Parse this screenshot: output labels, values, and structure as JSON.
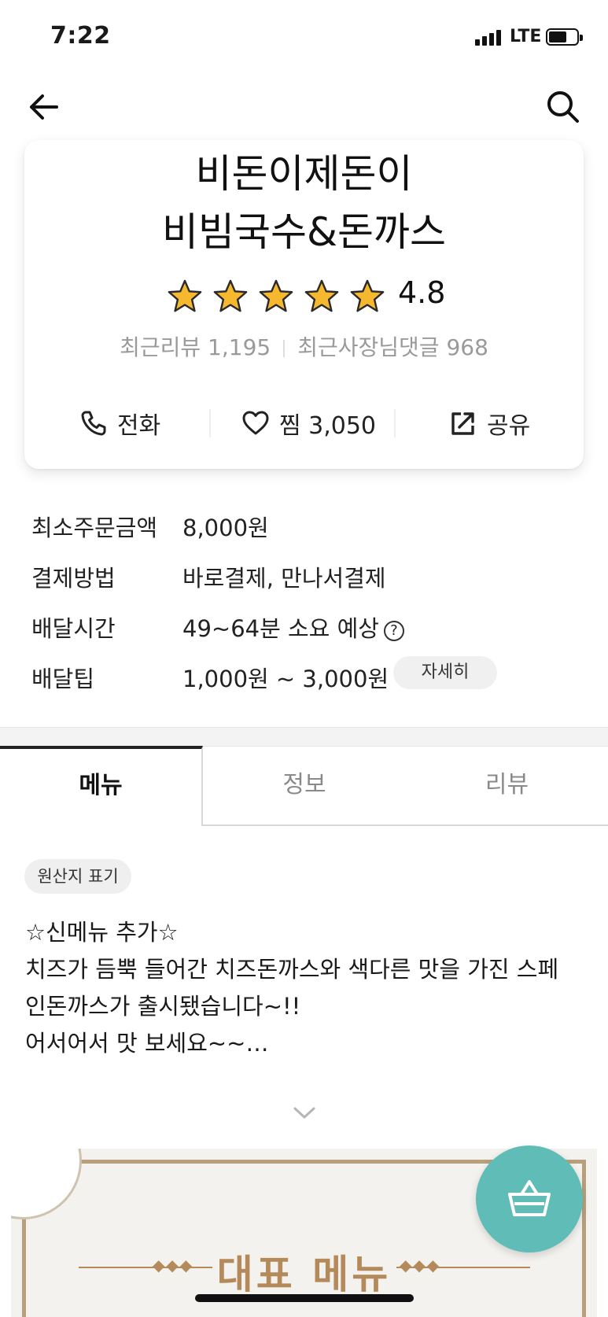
{
  "status_bar": {
    "time": "7:22",
    "network": "LTE"
  },
  "nav": {
    "back_icon": "arrow-left-icon",
    "search_icon": "search-icon"
  },
  "store": {
    "name_line1": "비돈이제돈이",
    "name_line2": "비빔국수&돈까스",
    "rating": 4.8,
    "rating_text": "4.8",
    "stars": 5,
    "recent_reviews": "최근리뷰 1,195",
    "recent_owner_replies": "최근사장님댓글 968"
  },
  "actions": {
    "call": {
      "label": "전화",
      "icon": "phone-icon"
    },
    "favorite": {
      "label": "찜 3,050",
      "icon": "heart-icon"
    },
    "share": {
      "label": "공유",
      "icon": "share-icon"
    }
  },
  "info": {
    "min_order": {
      "label": "최소주문금액",
      "value": "8,000원"
    },
    "payment": {
      "label": "결제방법",
      "value": "바로결제, 만나서결제"
    },
    "delivery_time": {
      "label": "배달시간",
      "value": "49~64분 소요 예상",
      "help": "?"
    },
    "delivery_tip": {
      "label": "배달팁",
      "value": "1,000원 ~ 3,000원",
      "detail_button": "자세히"
    }
  },
  "tabs": [
    {
      "label": "메뉴",
      "active": true
    },
    {
      "label": "정보",
      "active": false
    },
    {
      "label": "리뷰",
      "active": false
    }
  ],
  "origin_chip": "원산지 표기",
  "notice": {
    "line1": "☆신메뉴 추가☆",
    "line2": "치즈가 듬뿍 들어간 치즈돈까스와 색다른 맛을 가진 스페",
    "line3": "인돈까스가 출시됐습니다~!!",
    "line4": "어서어서 맛 보세요~~…"
  },
  "banner": {
    "title": "대표 메뉴"
  },
  "cart": {
    "icon": "shopping-basket-icon"
  },
  "colors": {
    "accent": "#5fbcb7",
    "star": "#f5b82e",
    "banner_gold": "#b48a5a"
  }
}
